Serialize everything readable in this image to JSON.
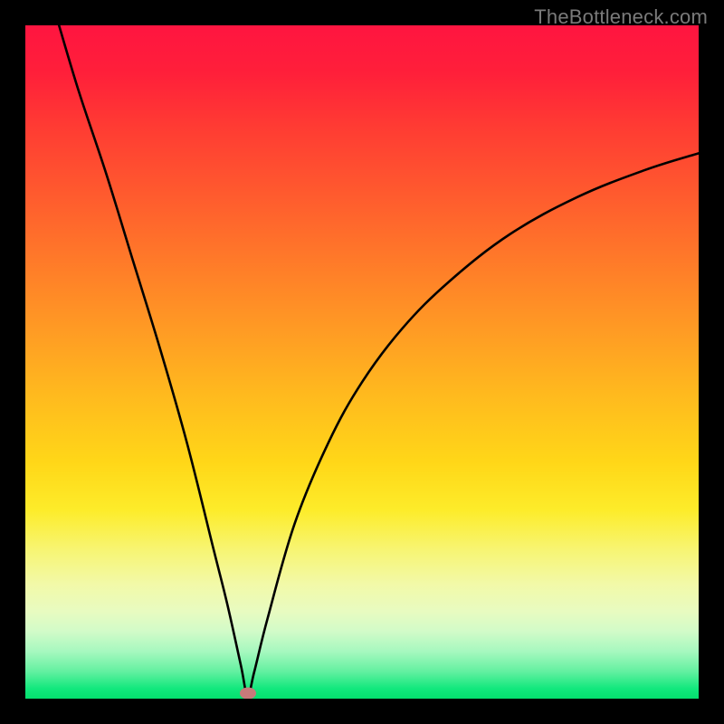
{
  "watermark": "TheBottleneck.com",
  "chart_data": {
    "type": "line",
    "title": "",
    "xlabel": "",
    "ylabel": "",
    "xlim": [
      0,
      100
    ],
    "ylim": [
      0,
      100
    ],
    "note": "V-shaped curve on a red-to-green vertical gradient. The curve descends from top-left, reaches a sharp minimum near the bottom at x≈33, then rises asymptotically toward the upper-right. A small marker sits at the minimum.",
    "series": [
      {
        "name": "curve",
        "x": [
          5,
          8,
          12,
          16,
          20,
          24,
          28,
          30,
          32,
          33,
          34,
          36,
          40,
          45,
          50,
          56,
          63,
          72,
          82,
          92,
          100
        ],
        "y": [
          100,
          90,
          78,
          65,
          52,
          38,
          22,
          14,
          5,
          0.5,
          4,
          12,
          26,
          38,
          47,
          55,
          62,
          69,
          74.5,
          78.5,
          81
        ]
      }
    ],
    "marker": {
      "x": 33,
      "y": 0.8
    },
    "colors": {
      "top": "#ff1540",
      "mid": "#ffd718",
      "bottom": "#04df6e",
      "curve": "#000000",
      "marker": "#c77a7a",
      "frame": "#000000"
    }
  }
}
